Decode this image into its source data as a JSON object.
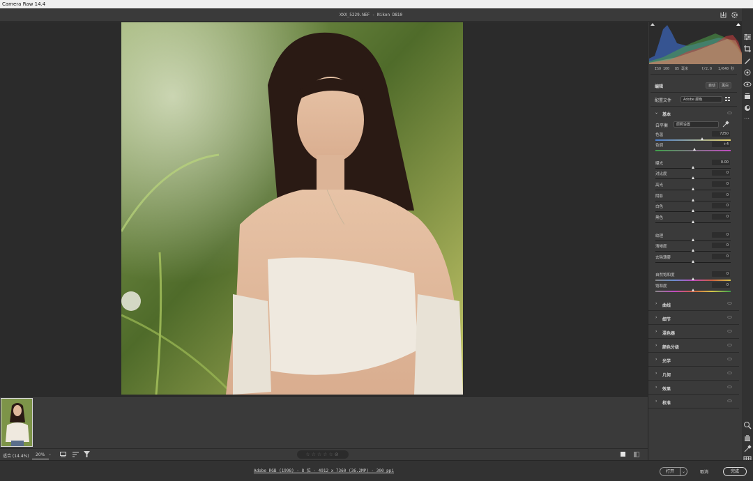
{
  "window": {
    "title": "Camera Raw 14.4"
  },
  "document": {
    "title": "XXX_5229.NEF  -  Nikon D810"
  },
  "camera_info": {
    "iso": "ISO 100",
    "focal": "85 毫米",
    "aperture": "f/2.0",
    "shutter": "1/640 秒"
  },
  "panel": {
    "edit_label": "编辑",
    "auto_button": "自动",
    "bw_button": "黑白",
    "profile_label": "配置文件",
    "profile_value": "Adobe 颜色",
    "basic_section": "基本",
    "wb_label": "白平衡",
    "wb_value": "原照设置",
    "sliders": [
      {
        "label": "色温",
        "value": "7250",
        "pos": 0.62
      },
      {
        "label": "色调",
        "value": "+4",
        "pos": 0.52
      },
      {
        "label": "曝光",
        "value": "0.00",
        "pos": 0.5
      },
      {
        "label": "对比度",
        "value": "0",
        "pos": 0.5
      },
      {
        "label": "高光",
        "value": "0",
        "pos": 0.5
      },
      {
        "label": "阴影",
        "value": "0",
        "pos": 0.5
      },
      {
        "label": "白色",
        "value": "0",
        "pos": 0.5
      },
      {
        "label": "黑色",
        "value": "0",
        "pos": 0.5
      },
      {
        "label": "纹理",
        "value": "0",
        "pos": 0.5
      },
      {
        "label": "清晰度",
        "value": "0",
        "pos": 0.5
      },
      {
        "label": "去除薄雾",
        "value": "0",
        "pos": 0.5
      },
      {
        "label": "自然饱和度",
        "value": "0",
        "pos": 0.5
      },
      {
        "label": "饱和度",
        "value": "0",
        "pos": 0.5
      }
    ],
    "sections": [
      "曲线",
      "细节",
      "混色器",
      "颜色分级",
      "光学",
      "几何",
      "效果",
      "校准"
    ]
  },
  "bottom": {
    "fit_label": "适合 (14.4%)",
    "zoom_value": "20%"
  },
  "footer": {
    "info": "Adobe RGB (1998) - 8 位 - 4912 x 7360 (36.2MP) - 300 ppi",
    "open_button": "打开",
    "cancel_button": "取消",
    "done_button": "完成"
  },
  "colors": {
    "accent": "#ffffff",
    "panel_bg": "#3a3a3a",
    "stage_bg": "#2b2b2b"
  }
}
